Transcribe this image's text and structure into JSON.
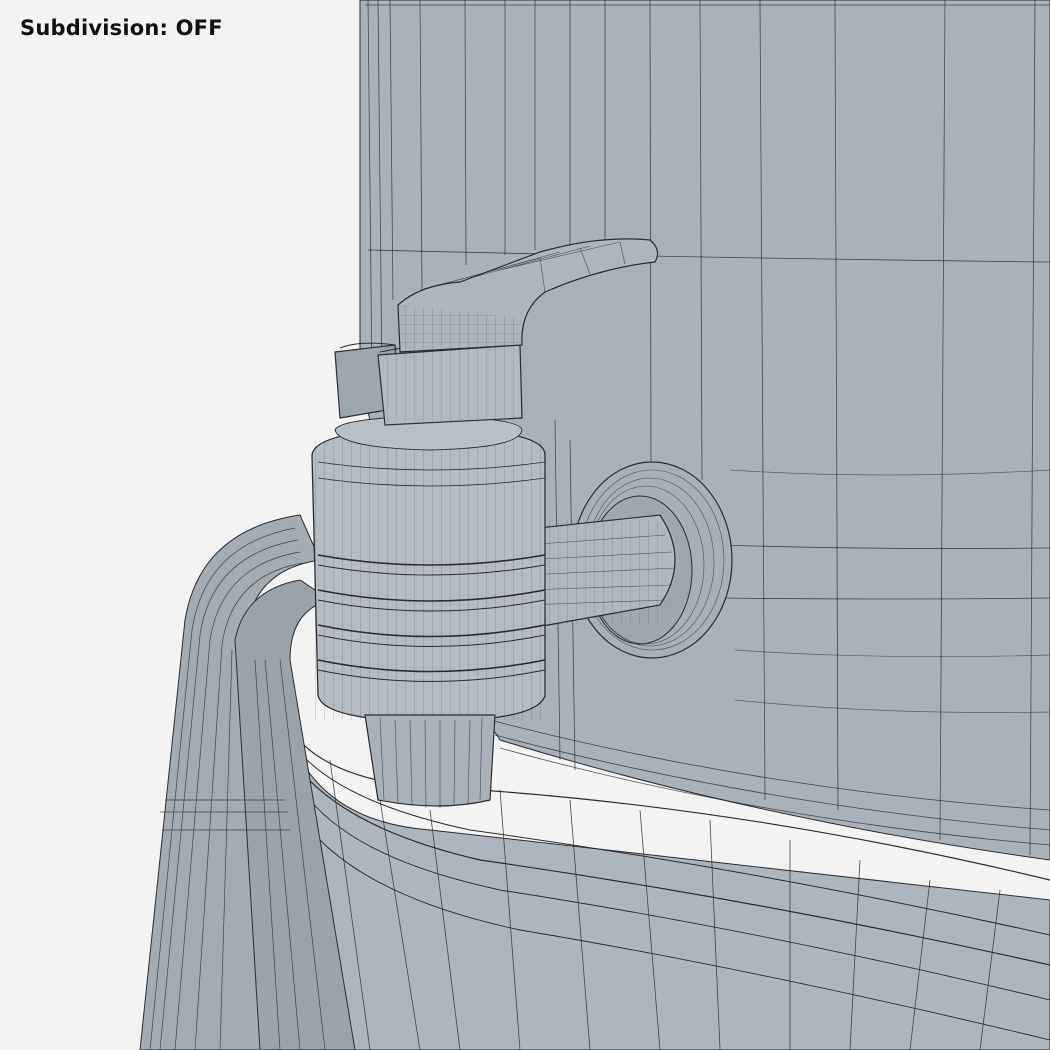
{
  "overlay": {
    "subdivision_label": "Subdivision: OFF"
  },
  "colors": {
    "background": "#f3f3f3",
    "surface": "#a8b0b8",
    "surface_dark": "#8e979f",
    "surface_light": "#bcc3ca",
    "wire": "#2a2e33"
  }
}
